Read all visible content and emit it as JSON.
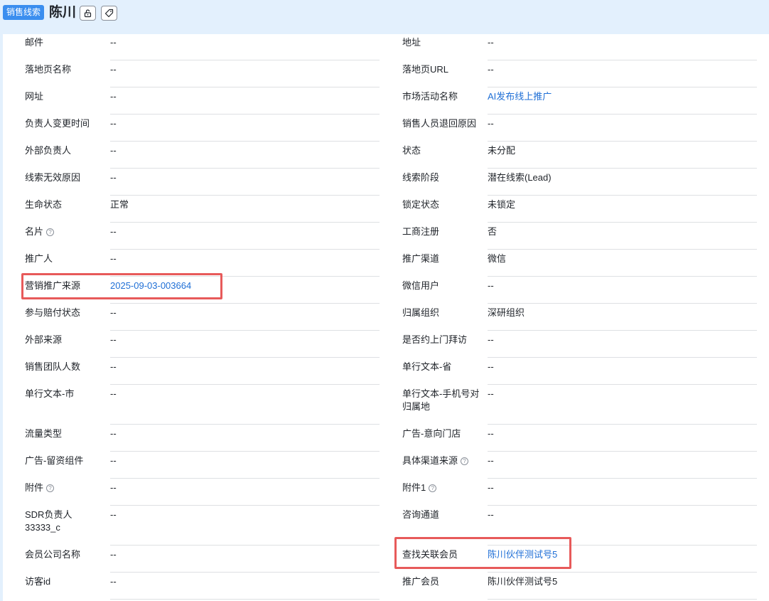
{
  "header": {
    "tag": "销售线索",
    "name": "陈川",
    "lock_icon": "unlock-icon",
    "tag_icon": "price-tag-icon"
  },
  "left": [
    {
      "label": "邮件",
      "value": "--"
    },
    {
      "label": "落地页名称",
      "value": "--"
    },
    {
      "label": "网址",
      "value": "--"
    },
    {
      "label": "负责人变更时间",
      "value": "--"
    },
    {
      "label": "外部负责人",
      "value": "--"
    },
    {
      "label": "线索无效原因",
      "value": "--"
    },
    {
      "label": "生命状态",
      "value": "正常"
    },
    {
      "label": "名片",
      "value": "--",
      "help": "?"
    },
    {
      "label": "推广人",
      "value": "--"
    },
    {
      "label": "营销推广来源",
      "value": "2025-09-03-003664",
      "link": true
    },
    {
      "label": "参与赔付状态",
      "value": "--"
    },
    {
      "label": "外部来源",
      "value": "--"
    },
    {
      "label": "销售团队人数",
      "value": "--"
    },
    {
      "label": "单行文本-市",
      "value": "--"
    },
    {
      "label": "流量类型",
      "value": "--"
    },
    {
      "label": "广告-留资组件",
      "value": "--"
    },
    {
      "label": "附件",
      "value": "--",
      "help": "?"
    },
    {
      "label": "SDR负责人33333_c",
      "value": "--"
    },
    {
      "label": "会员公司名称",
      "value": "--"
    },
    {
      "label": "访客id",
      "value": "--"
    }
  ],
  "right": [
    {
      "label": "地址",
      "value": "--"
    },
    {
      "label": "落地页URL",
      "value": "--"
    },
    {
      "label": "市场活动名称",
      "value": "AI发布线上推广",
      "link": true
    },
    {
      "label": "销售人员退回原因",
      "value": "--"
    },
    {
      "label": "状态",
      "value": "未分配"
    },
    {
      "label": "线索阶段",
      "value": "潜在线索(Lead)"
    },
    {
      "label": "锁定状态",
      "value": "未锁定"
    },
    {
      "label": "工商注册",
      "value": "否"
    },
    {
      "label": "推广渠道",
      "value": "微信"
    },
    {
      "label": "微信用户",
      "value": "--"
    },
    {
      "label": "归属组织",
      "value": "深研组织"
    },
    {
      "label": "是否约上门拜访",
      "value": "--"
    },
    {
      "label": "单行文本-省",
      "value": "--"
    },
    {
      "label": "单行文本-手机号对归属地",
      "value": "--"
    },
    {
      "label": "广告-意向门店",
      "value": "--"
    },
    {
      "label": "具体渠道来源",
      "value": "--",
      "help": "?"
    },
    {
      "label": "附件1",
      "value": "--",
      "help": "?"
    },
    {
      "label": "咨询通道",
      "value": "--"
    },
    {
      "label": "查找关联会员",
      "value": "陈川伙伴测试号5",
      "link": true
    },
    {
      "label": "推广会员",
      "value": "陈川伙伴测试号5"
    }
  ]
}
